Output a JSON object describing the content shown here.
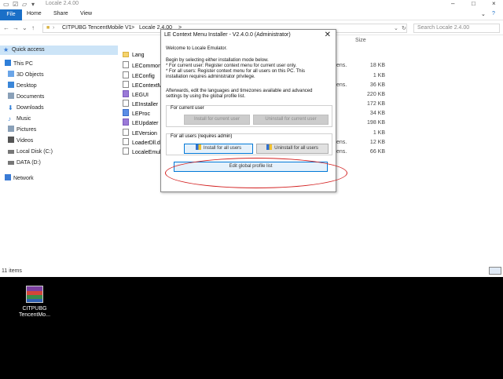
{
  "window": {
    "title": "Locale 2.4.00",
    "ribbon_tabs": [
      "File",
      "Home",
      "Share",
      "View"
    ],
    "breadcrumb": [
      "CITPUBG TencentMobile V1",
      ">",
      "Locale 2.4.00",
      ">"
    ],
    "search_placeholder": "Search Locale 2.4.00",
    "size_header": "Size",
    "status": "11 items"
  },
  "sidebar": [
    {
      "label": "Quick access",
      "icon": "star-icon",
      "color": "#3a7bd5"
    },
    {
      "label": "This PC",
      "icon": "computer-icon",
      "color": "#2f7fd9"
    },
    {
      "label": "3D Objects",
      "icon": "cube-icon",
      "color": "#6aa5e8"
    },
    {
      "label": "Desktop",
      "icon": "desktop-icon",
      "color": "#3a86d8"
    },
    {
      "label": "Documents",
      "icon": "documents-icon",
      "color": "#8aa0b8"
    },
    {
      "label": "Downloads",
      "icon": "download-icon",
      "color": "#2f7fd9"
    },
    {
      "label": "Music",
      "icon": "music-icon",
      "color": "#2f7fd9"
    },
    {
      "label": "Pictures",
      "icon": "pictures-icon",
      "color": "#8aa0b8"
    },
    {
      "label": "Videos",
      "icon": "videos-icon",
      "color": "#555"
    },
    {
      "label": "Local Disk (C:)",
      "icon": "disk-icon",
      "color": "#777"
    },
    {
      "label": "DATA (D:)",
      "icon": "disk-icon",
      "color": "#777"
    },
    {
      "label": "Network",
      "icon": "network-icon",
      "color": "#3a7bd5"
    }
  ],
  "files": [
    {
      "name": "Lang",
      "icon": "folder",
      "type": "",
      "size": ""
    },
    {
      "name": "LECommon",
      "icon": "doc",
      "type": "ens...",
      "size": "18 KB"
    },
    {
      "name": "LEConfig",
      "icon": "doc",
      "type": "",
      "size": "1 KB"
    },
    {
      "name": "LEContextM",
      "icon": "doc",
      "type": "ens...",
      "size": "36 KB"
    },
    {
      "name": "LEGUI",
      "icon": "purple",
      "type": "",
      "size": "220 KB"
    },
    {
      "name": "LEInstaller",
      "icon": "doc",
      "type": "",
      "size": "172 KB"
    },
    {
      "name": "LEProc",
      "icon": "blue",
      "type": "",
      "size": "34 KB"
    },
    {
      "name": "LEUpdater",
      "icon": "purple",
      "type": "",
      "size": "198 KB"
    },
    {
      "name": "LEVersion",
      "icon": "doc",
      "type": "",
      "size": "1 KB"
    },
    {
      "name": "LoaderDll.dll",
      "icon": "doc",
      "type": "ens...",
      "size": "12 KB"
    },
    {
      "name": "LocaleEmul",
      "icon": "doc",
      "type": "ens...",
      "size": "66 KB"
    }
  ],
  "dialog": {
    "title": "LE Context Menu Installer - V2.4.0.0 (Administrator)",
    "welcome": "Welcome to Locale Emulator.",
    "intro": [
      "Begin by selecting either installation mode below.",
      " * For current user: Register context menu for current user only.",
      " * For all users: Register context menu for all users on this PC. This",
      "installation requires administrator privilege."
    ],
    "after": [
      "Afterwards, edit the languages and timezones available and advanced",
      "settings by using the global profile list."
    ],
    "group_current": "For current user",
    "install_current": "Install for current user",
    "uninstall_current": "Uninstall for current user",
    "group_all": "For all users (requires admin)",
    "install_all": "Install for all users",
    "uninstall_all": "Uninstall for all users",
    "edit_profile": "Edit global profile list"
  },
  "desktop": {
    "icon_label_line1": "CITPUBG",
    "icon_label_line2": "TencentMo..."
  },
  "colors": {
    "accent": "#1a6fc7",
    "highlight_oval": "#d32020",
    "desktop_bg": "#000000"
  }
}
